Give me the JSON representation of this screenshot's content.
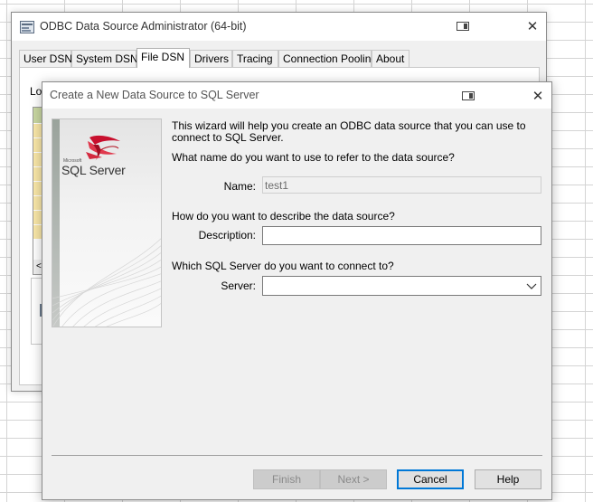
{
  "parent_window": {
    "title": "ODBC Data Source Administrator (64-bit)",
    "close_glyph": "✕",
    "tabs": [
      {
        "label": "User DSN",
        "active": false
      },
      {
        "label": "System DSN",
        "active": false
      },
      {
        "label": "File DSN",
        "active": true
      },
      {
        "label": "Drivers",
        "active": false
      },
      {
        "label": "Tracing",
        "active": false
      },
      {
        "label": "Connection Pooling",
        "active": false
      },
      {
        "label": "About",
        "active": false
      }
    ],
    "panel_fragment": "Lo",
    "list_scroll_glyph": "<"
  },
  "dialog": {
    "title": "Create a New Data Source to SQL Server",
    "close_glyph": "✕",
    "brand": {
      "microsoft": "Microsoft",
      "product": "SQL Server"
    },
    "intro_text": "This wizard will help you create an ODBC data source that you can use to connect to SQL Server.",
    "name_question": "What name do you want to use to refer to the data source?",
    "name_label": "Name:",
    "name_value": "test1",
    "description_question": "How do you want to describe the data source?",
    "description_label": "Description:",
    "description_value": "",
    "server_question": "Which SQL Server do you want to connect to?",
    "server_label": "Server:",
    "server_value": "",
    "buttons": {
      "finish": "Finish",
      "next": "Next >",
      "cancel": "Cancel",
      "help": "Help"
    }
  },
  "colors": {
    "accent": "#0078d7",
    "window_bg": "#f0f0f0",
    "logo_red": "#c8102e"
  }
}
